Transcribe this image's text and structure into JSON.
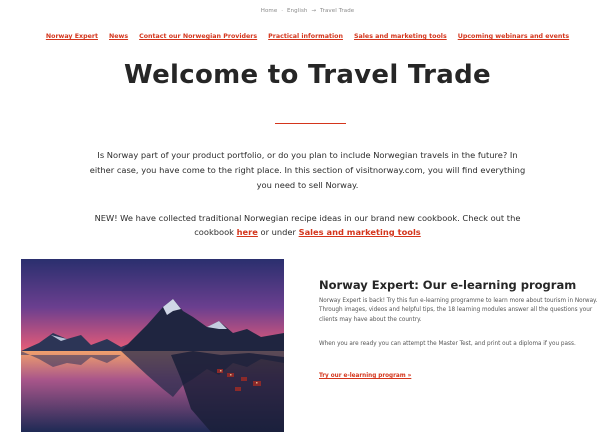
{
  "breadcrumb": {
    "home": "Home",
    "sep1": "·",
    "language": "English",
    "sep2": "→",
    "current": "Travel Trade"
  },
  "subnav": {
    "items": [
      {
        "label": "Norway Expert"
      },
      {
        "label": "News"
      },
      {
        "label": "Contact our Norwegian Providers"
      },
      {
        "label": "Practical information"
      },
      {
        "label": "Sales and marketing tools"
      },
      {
        "label": "Upcoming webinars and events"
      }
    ]
  },
  "main": {
    "title": "Welcome to Travel Trade",
    "intro": "Is Norway part of your product portfolio, or do you plan to include Norwegian travels in the future? In either case, you have come to the right place. In this section of visitnorway.com, you will find everything you need to sell Norway.",
    "news_prefix": "NEW! We have collected traditional Norwegian recipe ideas in our brand new cookbook. Check out the cookbook ",
    "news_link1": "here",
    "news_middle": " or under ",
    "news_link2": "Sales and marketing tools"
  },
  "card": {
    "title": "Norway Expert: Our e-learning program",
    "body": "Norway Expert is back! Try this fun e-learning programme to learn more about tourism in Norway. Through images, videos and helpful tips, the 18 learning modules answer all the questions your clients may have about the country.",
    "body2": "When you are ready you can attempt the Master Test, and print out a diploma if you pass.",
    "link": "Try our e-learning program »"
  },
  "colors": {
    "accent": "#d4351c",
    "text": "#2b2b2b"
  }
}
